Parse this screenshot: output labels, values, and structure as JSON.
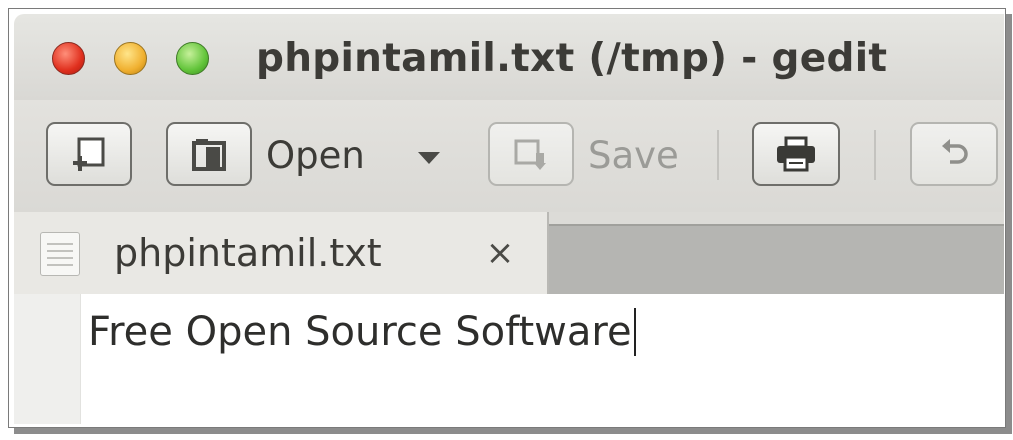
{
  "window": {
    "title": "phpintamil.txt (/tmp) - gedit"
  },
  "toolbar": {
    "new_icon": "new-document-icon",
    "open_label": "Open",
    "open_icon": "open-folder-icon",
    "open_dropdown_icon": "chevron-down-icon",
    "save_label": "Save",
    "save_icon": "save-icon",
    "save_enabled": false,
    "print_icon": "print-icon",
    "undo_icon": "undo-icon"
  },
  "tabs": [
    {
      "label": "phpintamil.txt",
      "icon": "text-file-icon",
      "close_glyph": "×",
      "active": true
    }
  ],
  "editor": {
    "lines": [
      "Free Open Source Software"
    ]
  },
  "colors": {
    "close_button": "#e0301e",
    "minimize_button": "#f0b030",
    "maximize_button": "#62c43a",
    "chrome_background": "#dcdbd7",
    "text": "#3c3b37"
  }
}
